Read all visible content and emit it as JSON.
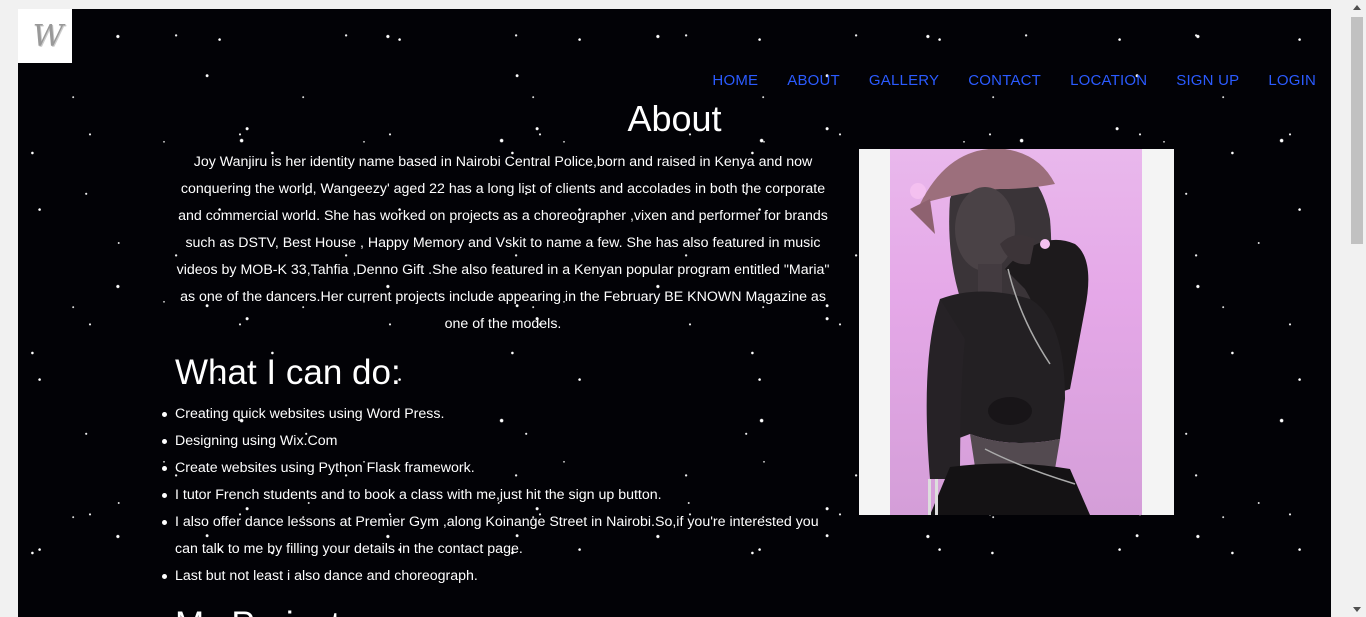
{
  "site": {
    "logo_text": "W"
  },
  "nav": {
    "items": [
      "HOME",
      "ABOUT",
      "GALLERY",
      "CONTACT",
      "LOCATION",
      "SIGN UP",
      "LOGIN"
    ]
  },
  "about": {
    "title": "About",
    "bio": "Joy Wanjiru is her identity name based in Nairobi Central Police,born and raised in Kenya and now conquering the world, Wangeezy' aged 22 has a long list of clients and accolades in both the corporate and commercial world. She has worked on projects as a choreographer ,vixen and performer for brands such as DSTV, Best House , Happy Memory and Vskit to name a few. She has also featured in music videos by MOB-K 33,Tahfia ,Denno Gift .She also featured in a Kenyan popular program entitled \"Maria\" as one of the dancers.Her current projects include appearing in the February BE KNOWN Magazine as one of the models."
  },
  "cando": {
    "title": "What I can do:",
    "items": [
      "Creating quick websites using Word Press.",
      "Designing using Wix.Com",
      "Create websites using Python Flask framework.",
      "I tutor French students and to book a class with me,just hit the sign up button.",
      "I also offer dance lessons at Premier Gym ,along Koinange Street in Nairobi.So,if you're interested you can talk to me by filling your details in the contact page.",
      "Last but not least i also dance and choreograph."
    ]
  },
  "next_section": {
    "title": "My Projects"
  },
  "colors": {
    "nav_link": "#2b5bff",
    "background": "#020206",
    "photo_bg": "#e5a8e8"
  }
}
